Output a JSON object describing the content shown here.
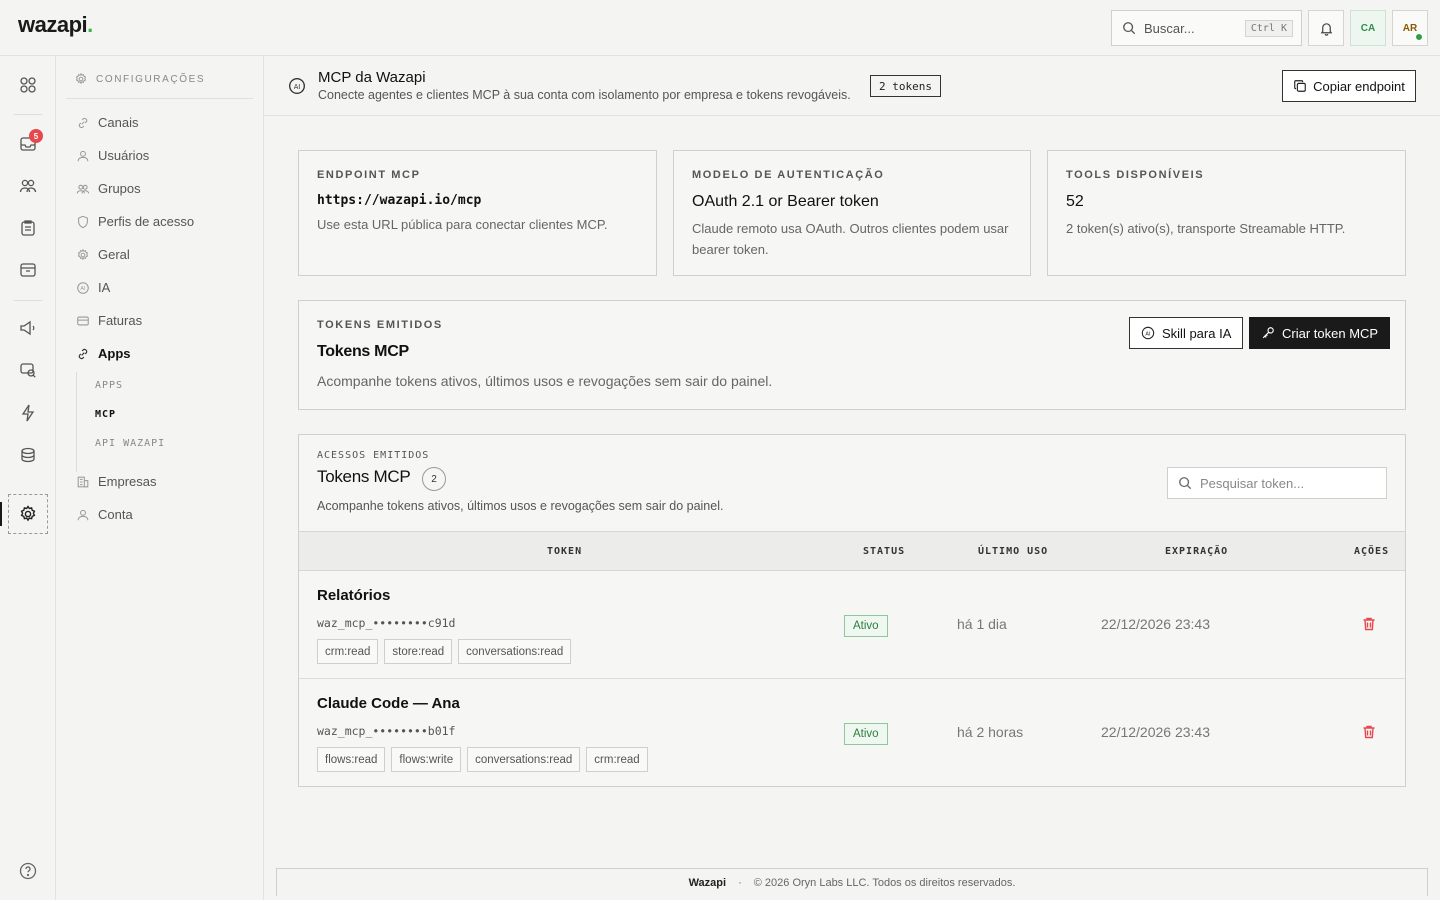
{
  "app": {
    "logo": "wazapi",
    "logo_dot": "."
  },
  "topbar": {
    "search_placeholder": "Buscar...",
    "search_shortcut": "Ctrl K",
    "user_initials_1": "CA",
    "user_initials_2": "AR",
    "notifications_badge": "5"
  },
  "sidebar": {
    "heading": "CONFIGURAÇÕES",
    "items": [
      {
        "label": "Canais",
        "icon": "link-icon"
      },
      {
        "label": "Usuários",
        "icon": "user-icon"
      },
      {
        "label": "Grupos",
        "icon": "users-icon"
      },
      {
        "label": "Perfis de acesso",
        "icon": "shield-icon"
      },
      {
        "label": "Geral",
        "icon": "gear-icon"
      },
      {
        "label": "IA",
        "icon": "ai-icon"
      },
      {
        "label": "Faturas",
        "icon": "card-icon"
      },
      {
        "label": "Apps",
        "icon": "plug-icon"
      },
      {
        "label": "Empresas",
        "icon": "building-icon"
      },
      {
        "label": "Conta",
        "icon": "user-icon"
      }
    ],
    "sub_items": [
      "APPS",
      "MCP",
      "API WAZAPI"
    ]
  },
  "header": {
    "title": "MCP da Wazapi",
    "subtitle": "Conecte agentes e clientes MCP à sua conta com isolamento por empresa e tokens revogáveis.",
    "badge": "2 tokens",
    "copy_button": "Copiar endpoint"
  },
  "cards": {
    "endpoint": {
      "label": "ENDPOINT MCP",
      "value": "https://wazapi.io/mcp",
      "desc": "Use esta URL pública para conectar clientes MCP."
    },
    "auth": {
      "label": "MODELO DE AUTENTICAÇÃO",
      "value": "OAuth 2.1 or Bearer token",
      "desc": "Claude remoto usa OAuth. Outros clientes podem usar bearer token."
    },
    "tools": {
      "label": "TOOLS DISPONÍVEIS",
      "value": "52",
      "desc": "2 token(s) ativo(s), transporte Streamable HTTP."
    }
  },
  "tokens_panel": {
    "label": "TOKENS EMITIDOS",
    "title": "Tokens MCP",
    "desc": "Acompanhe tokens ativos, últimos usos e revogações sem sair do painel.",
    "skill_button": "Skill para IA",
    "create_button": "Criar token MCP"
  },
  "table_panel": {
    "label": "ACESSOS EMITIDOS",
    "title": "Tokens MCP",
    "count": "2",
    "desc": "Acompanhe tokens ativos, últimos usos e revogações sem sair do painel.",
    "search_placeholder": "Pesquisar token...",
    "columns": [
      "TOKEN",
      "STATUS",
      "ÚLTIMO USO",
      "EXPIRAÇÃO",
      "AÇÕES"
    ],
    "rows": [
      {
        "name": "Relatórios",
        "key": "waz_mcp_••••••••c91d",
        "scopes": [
          "crm:read",
          "store:read",
          "conversations:read"
        ],
        "status": "Ativo",
        "last_used": "há 1 dia",
        "expires": "22/12/2026 23:43"
      },
      {
        "name": "Claude Code — Ana",
        "key": "waz_mcp_••••••••b01f",
        "scopes": [
          "flows:read",
          "flows:write",
          "conversations:read",
          "crm:read"
        ],
        "status": "Ativo",
        "last_used": "há 2 horas",
        "expires": "22/12/2026 23:43"
      }
    ]
  },
  "footer": {
    "brand": "Wazapi",
    "sep": "·",
    "copyright": "© 2026 Oryn Labs LLC. Todos os direitos reservados."
  }
}
